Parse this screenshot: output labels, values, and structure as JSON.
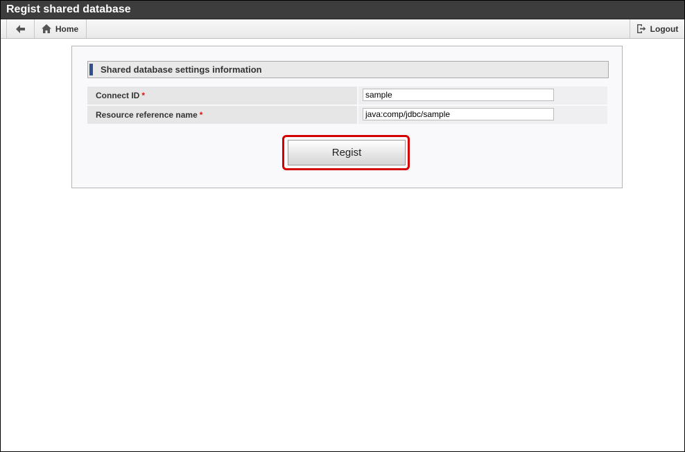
{
  "window": {
    "title": "Regist shared database"
  },
  "toolbar": {
    "back_icon": "arrow-left-icon",
    "home_label": "Home",
    "home_icon": "home-icon",
    "logout_label": "Logout",
    "logout_icon": "logout-icon"
  },
  "section": {
    "title": "Shared database settings information"
  },
  "fields": [
    {
      "label": "Connect ID",
      "required_mark": "*",
      "value": "sample"
    },
    {
      "label": "Resource reference name",
      "required_mark": "*",
      "value": "java:comp/jdbc/sample"
    }
  ],
  "actions": {
    "regist_label": "Regist"
  },
  "colors": {
    "titlebar": "#3d3d3d",
    "accent_bar": "#2f4f8f",
    "required": "#dd1111",
    "highlight": "#d40000"
  }
}
